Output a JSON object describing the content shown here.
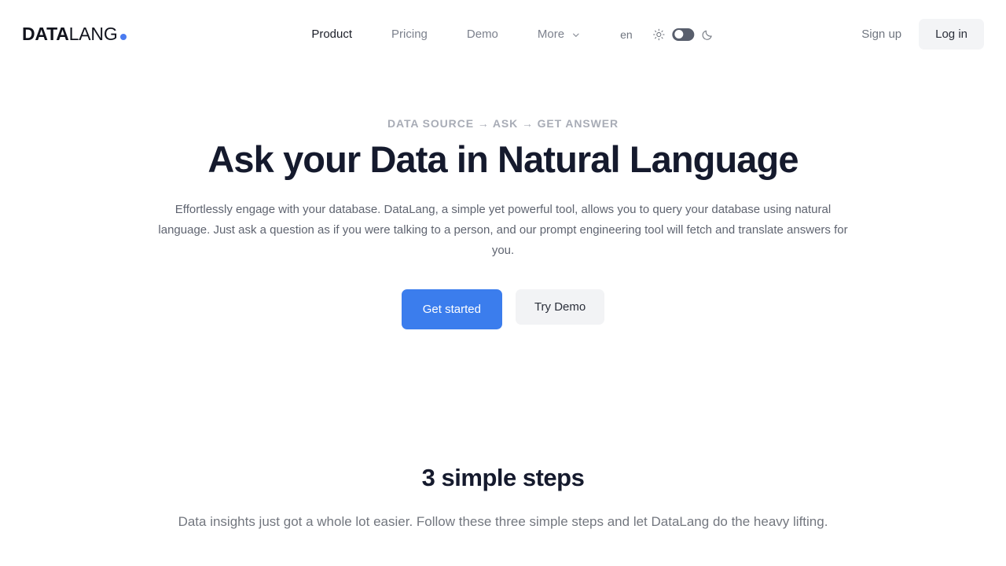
{
  "header": {
    "logo": {
      "bold": "DATA",
      "light": "LANG",
      "dot_color": "#4a7bf0"
    },
    "nav": [
      {
        "label": "Product",
        "active": true
      },
      {
        "label": "Pricing",
        "active": false
      },
      {
        "label": "Demo",
        "active": false
      },
      {
        "label": "More",
        "active": false,
        "has_chevron": true
      }
    ],
    "language": "en",
    "theme": {
      "light_icon": "sun-icon",
      "dark_icon": "moon-icon",
      "toggle_state": "light"
    },
    "signup_label": "Sign up",
    "login_label": "Log in"
  },
  "hero": {
    "eyebrow": "DATA SOURCE → ASK → GET ANSWER",
    "title": "Ask your Data in Natural Language",
    "description": "Effortlessly engage with your database. DataLang, a simple yet powerful tool, allows you to query your database using natural language. Just ask a question as if you were talking to a person, and our prompt engineering tool will fetch and translate answers for you.",
    "primary_cta": "Get started",
    "secondary_cta": "Try Demo",
    "primary_color": "#3b7ded"
  },
  "steps": {
    "title": "3 simple steps",
    "subtitle": "Data insights just got a whole lot easier. Follow these three simple steps and let DataLang do the heavy lifting."
  }
}
